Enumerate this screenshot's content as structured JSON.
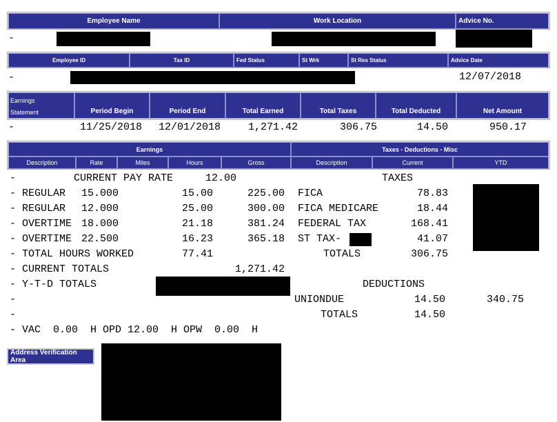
{
  "header1": {
    "employee_name": "Employee Name",
    "work_location": "Work Location",
    "advice_no": "Advice No.",
    "row_dash": "-"
  },
  "header2": {
    "employee_id": "Employee ID",
    "tax_id": "Tax ID",
    "fed_status": "Fed Status",
    "st_wrk": "St Wrk",
    "st_res_status": "St Res Status",
    "advice_date": "Advice Date",
    "row_dash": "-",
    "advice_date_value": "12/07/2018"
  },
  "earnings_statement": {
    "label_line1": "Earnings",
    "label_line2": "Statement",
    "period_begin": "Period Begin",
    "period_end": "Period End",
    "total_earned": "Total Earned",
    "total_taxes": "Total Taxes",
    "total_deducted": "Total Deducted",
    "net_amount": "Net Amount",
    "row": {
      "dash": "-",
      "period_begin": "11/25/2018",
      "period_end": "12/01/2018",
      "total_earned": "1,271.42",
      "total_taxes": "306.75",
      "total_deducted": "14.50",
      "net_amount": "950.17"
    }
  },
  "detail_headers": {
    "earnings": "Earnings",
    "taxes_deductions_misc": "Taxes - Deductions - Misc",
    "cols_left": [
      "Description",
      "Rate",
      "Miles",
      "Hours",
      "Gross"
    ],
    "cols_right": [
      "Description",
      "Current",
      "YTD"
    ]
  },
  "detail": {
    "pay_rate_label": "CURRENT PAY RATE",
    "pay_rate_value": "12.00",
    "taxes_heading": "TAXES",
    "earning_lines": [
      {
        "desc": "REGULAR",
        "rate": "15.000",
        "hours": "15.00",
        "gross": "225.00"
      },
      {
        "desc": "REGULAR",
        "rate": "12.000",
        "hours": "25.00",
        "gross": "300.00"
      },
      {
        "desc": "OVERTIME",
        "rate": "18.000",
        "hours": "21.18",
        "gross": "381.24"
      },
      {
        "desc": "OVERTIME",
        "rate": "22.500",
        "hours": "16.23",
        "gross": "365.18"
      }
    ],
    "tax_lines": [
      {
        "desc": "FICA",
        "current": "78.83"
      },
      {
        "desc": "FICA MEDICARE",
        "current": "18.44"
      },
      {
        "desc": "FEDERAL TAX",
        "current": "168.41"
      },
      {
        "desc": "ST TAX-",
        "current": "41.07"
      }
    ],
    "total_hours_label": "TOTAL HOURS WORKED",
    "total_hours_value": "77.41",
    "taxes_totals_label": "TOTALS",
    "taxes_totals_value": "306.75",
    "current_totals_label": "CURRENT TOTALS",
    "current_totals_value": "1,271.42",
    "ytd_totals_label": "Y-T-D TOTALS",
    "deductions_heading": "DEDUCTIONS",
    "deduction_lines": [
      {
        "desc": "UNIONDUE",
        "current": "14.50",
        "ytd": "340.75"
      }
    ],
    "deductions_totals_label": "TOTALS",
    "deductions_totals_value": "14.50",
    "leave_line": "VAC  0.00  H OPD 12.00  H OPW  0.00  H",
    "dash": "-"
  },
  "address": {
    "button_label": "Address Verification Area"
  },
  "colors": {
    "header_bg": "#2e3192",
    "redaction": "#000000"
  }
}
